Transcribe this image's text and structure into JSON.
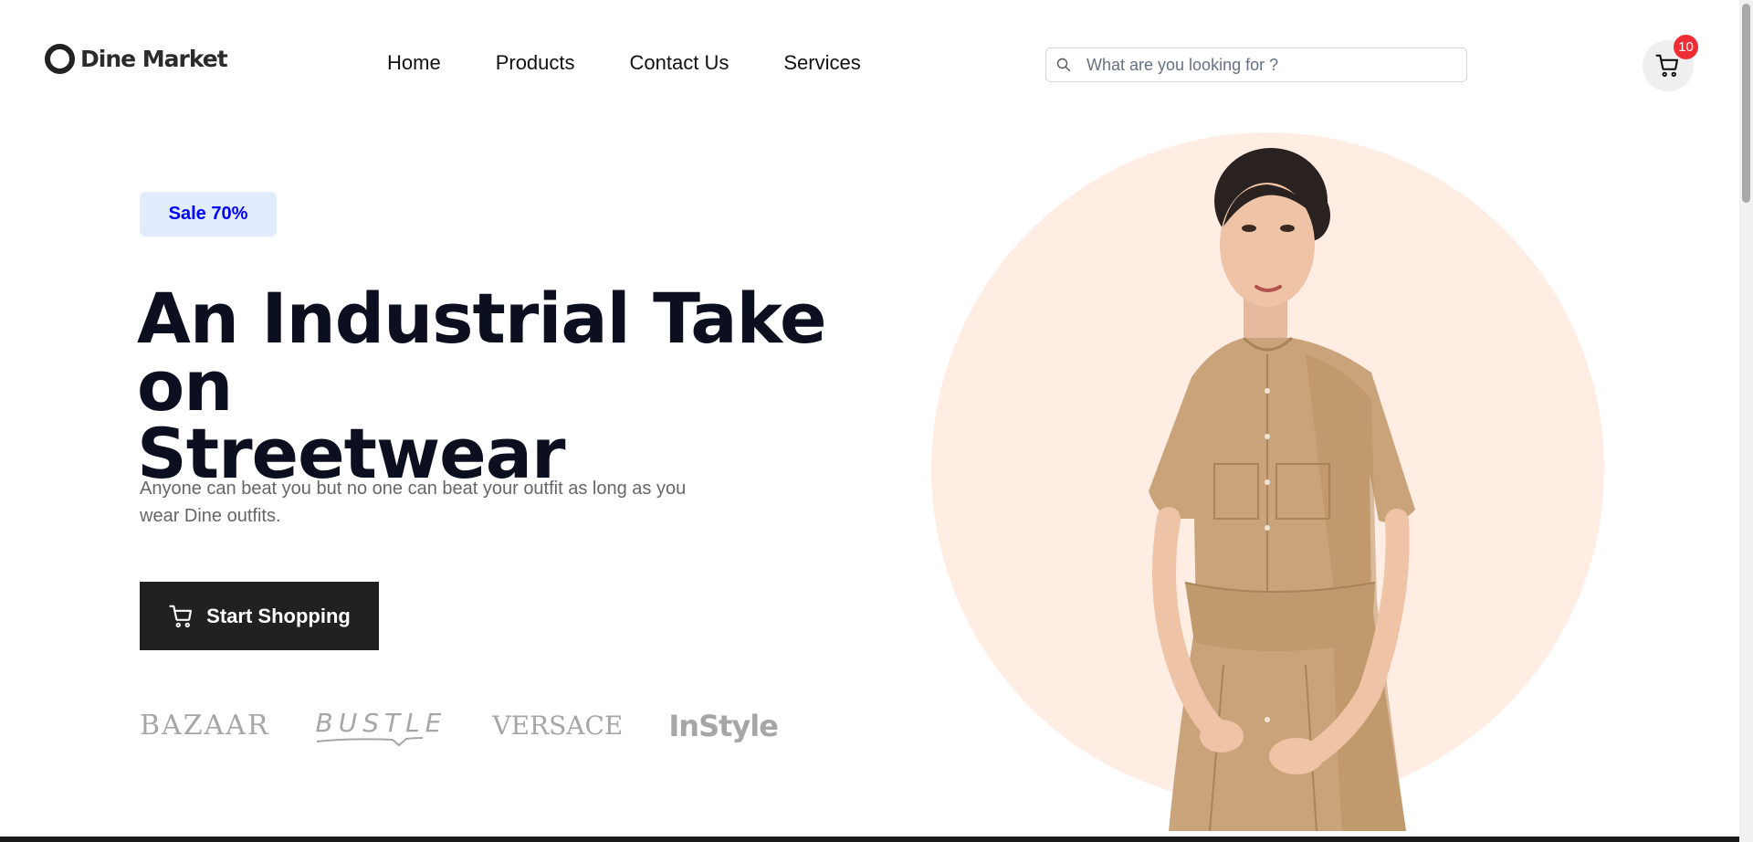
{
  "header": {
    "logo_text": "Dine Market",
    "nav": [
      {
        "label": "Home"
      },
      {
        "label": "Products"
      },
      {
        "label": "Contact Us"
      },
      {
        "label": "Services"
      }
    ],
    "search": {
      "placeholder": "What are you looking for ?",
      "value": "",
      "icon": "search-icon"
    },
    "cart": {
      "icon": "cart-icon",
      "count": "10"
    }
  },
  "hero": {
    "badge": "Sale 70%",
    "title_line1": "An Industrial Take on",
    "title_line2": "Streetwear",
    "description": "Anyone can beat you but no one can beat your outfit as long as you wear Dine outfits.",
    "cta_label": "Start Shopping",
    "cta_icon": "cart-icon",
    "brands": [
      "BAZAAR",
      "BUSTLE",
      "VERSACE",
      "InStyle"
    ],
    "image_alt": "Woman in a tan belted shirt dress"
  },
  "colors": {
    "primary_dark": "#212121",
    "badge_bg": "#e1edff",
    "badge_text": "#0000ff",
    "circle_bg": "#ffece3",
    "cart_badge": "#f02d34",
    "dress": "#c9a47a"
  }
}
